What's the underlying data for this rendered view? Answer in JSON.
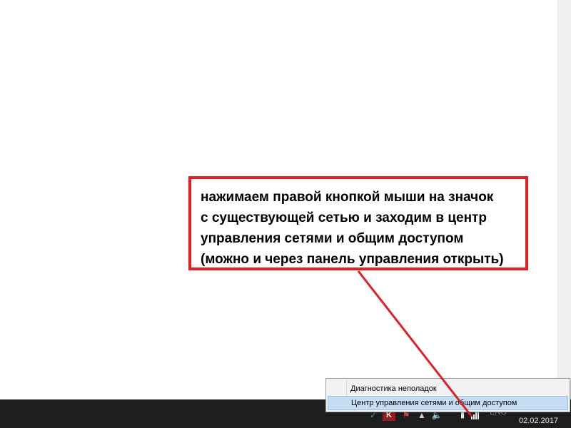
{
  "callout": {
    "lines": [
      "нажимаем правой кнопкой мыши на значок",
      "с существующей сетью и заходим в центр",
      "управления сетями и общим доступом",
      "(можно и через панель управления открыть)"
    ],
    "border_color": "#e01f26"
  },
  "context_menu": {
    "items": [
      {
        "label": "Диагностика неполадок",
        "highlighted": false
      },
      {
        "label": "Центр управления сетями и общим доступом",
        "highlighted": true
      }
    ]
  },
  "taskbar": {
    "tray_icons": [
      "shield-check-icon",
      "antivirus-icon",
      "flag-icon",
      "chevron-icon",
      "volume-icon",
      "battery-icon",
      "network-icon"
    ],
    "language": "ENG",
    "date": "02.02.2017"
  }
}
